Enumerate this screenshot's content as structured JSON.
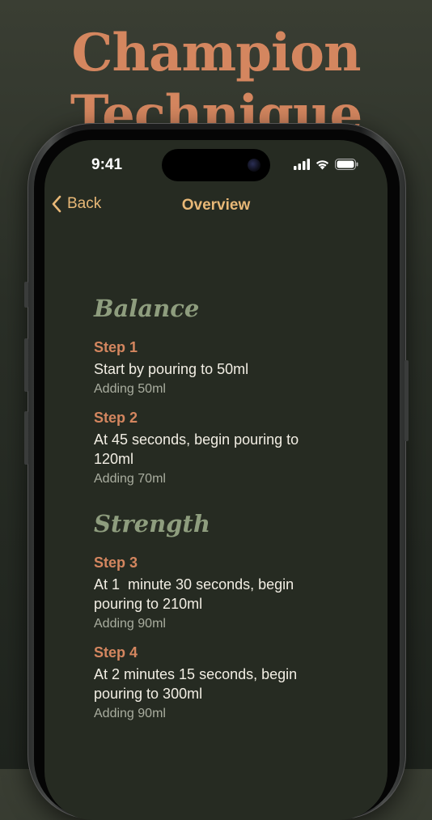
{
  "promo": {
    "headline_line1": "Champion",
    "headline_line2": "Technique"
  },
  "status_bar": {
    "time": "9:41",
    "icons": [
      "signal-icon",
      "wifi-icon",
      "battery-icon"
    ]
  },
  "nav": {
    "back_label": "Back",
    "title": "Overview"
  },
  "sections": [
    {
      "title": "Balance",
      "steps": [
        {
          "label": "Step 1",
          "description": "Start by pouring to 50ml",
          "adding": "Adding 50ml"
        },
        {
          "label": "Step 2",
          "description": "At 45 seconds, begin pouring to 120ml",
          "adding": "Adding 70ml"
        }
      ]
    },
    {
      "title": "Strength",
      "steps": [
        {
          "label": "Step 3",
          "description": "At 1  minute 30 seconds, begin pouring to 210ml",
          "adding": "Adding 90ml"
        },
        {
          "label": "Step 4",
          "description": "At 2 minutes 15 seconds, begin pouring to 300ml",
          "adding": "Adding 90ml"
        }
      ]
    }
  ],
  "colors": {
    "accent": "#d4865f",
    "nav_tint": "#e8b877",
    "section_title": "#8e9d7e",
    "screen_bg": "#262b22"
  }
}
